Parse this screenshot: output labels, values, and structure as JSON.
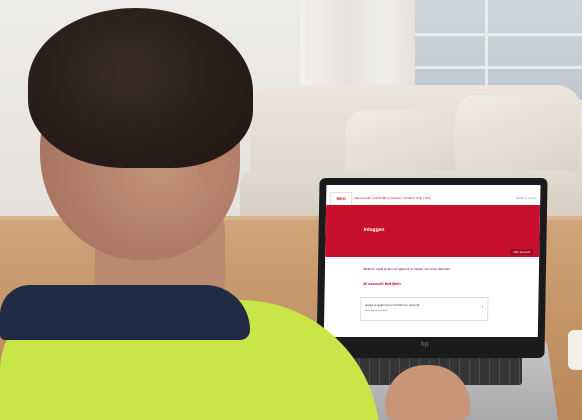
{
  "scene": {
    "description_colors": {
      "website_primary": "#c8102e",
      "shirt": "#c9e548",
      "collar": "#1f2a44"
    }
  },
  "screen": {
    "logo_text": "MKG",
    "nav_text": "Mijn account | Aanmelden | Nieuws | Contact | Help | FAQ",
    "nav_right_text": "Zoeken | Log in",
    "banner_title": "Inloggen",
    "banner_button": "Mijn account",
    "content_line": "Welkom, meld je aan om gebruik te maken van onze diensten",
    "content_heading": "Je account bekijken",
    "card_line1": "Bekijk je gegevens en beheer je account",
    "card_line2": "Ga naar je account",
    "card_chevron": "›"
  },
  "laptop": {
    "brand_mark": "hp"
  }
}
